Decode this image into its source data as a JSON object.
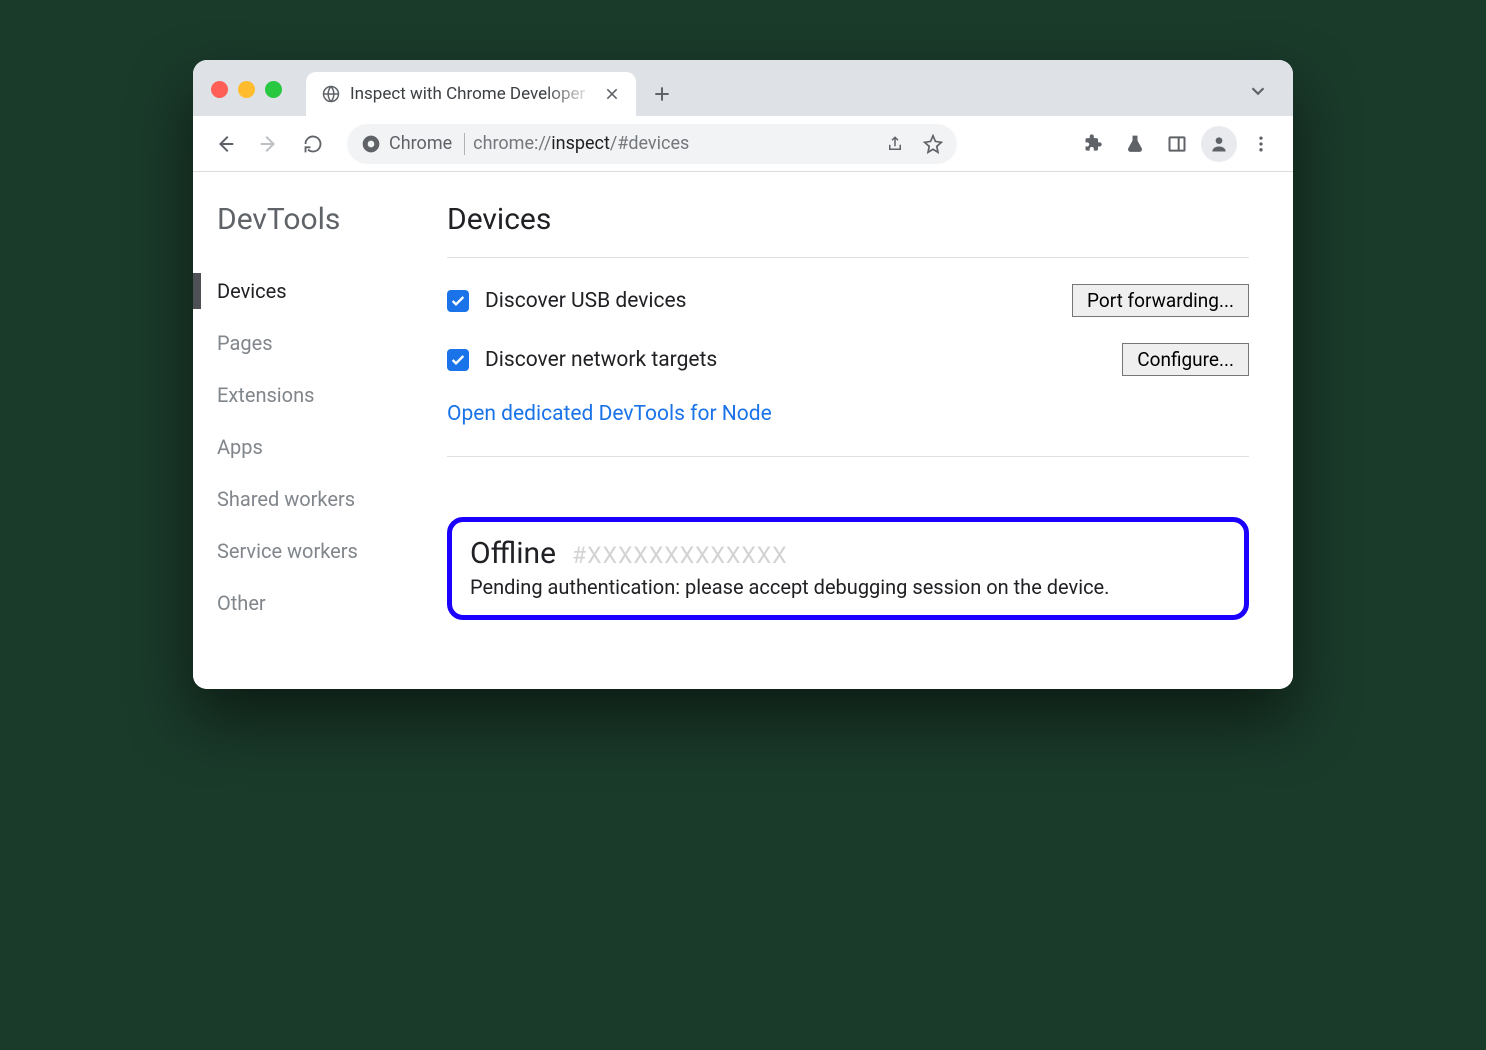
{
  "tab": {
    "title": "Inspect with Chrome Developer"
  },
  "omnibox": {
    "origin_label": "Chrome",
    "url_scheme": "chrome://",
    "url_host": "inspect",
    "url_path": "/#devices"
  },
  "sidebar": {
    "title": "DevTools",
    "items": [
      {
        "label": "Devices",
        "active": true
      },
      {
        "label": "Pages",
        "active": false
      },
      {
        "label": "Extensions",
        "active": false
      },
      {
        "label": "Apps",
        "active": false
      },
      {
        "label": "Shared workers",
        "active": false
      },
      {
        "label": "Service workers",
        "active": false
      },
      {
        "label": "Other",
        "active": false
      }
    ]
  },
  "page": {
    "title": "Devices",
    "options": [
      {
        "label": "Discover USB devices",
        "checked": true,
        "button": "Port forwarding..."
      },
      {
        "label": "Discover network targets",
        "checked": true,
        "button": "Configure..."
      }
    ],
    "node_link": "Open dedicated DevTools for Node"
  },
  "device": {
    "status": "Offline",
    "id": "#XXXXXXXXXXXXX",
    "message": "Pending authentication: please accept debugging session on the device."
  }
}
